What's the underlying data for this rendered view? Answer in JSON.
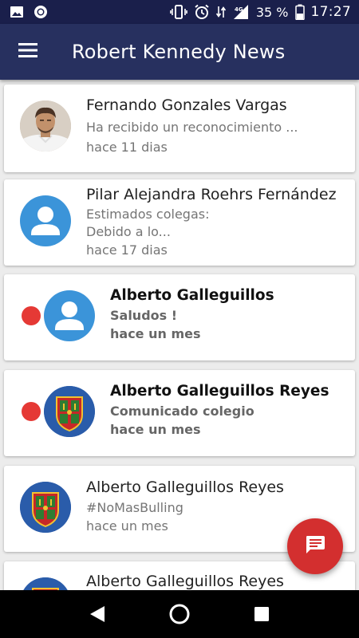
{
  "status_bar": {
    "battery_percent": "35 %",
    "time": "17:27",
    "network": "4G"
  },
  "app_bar": {
    "title": "Robert Kennedy News",
    "menu_icon": "hamburger-menu-icon"
  },
  "messages": [
    {
      "sender": "Fernando Gonzales Vargas",
      "preview": "Ha recibido un reconocimiento ...",
      "time": "hace 11 dias",
      "avatar": "photo",
      "unread": false
    },
    {
      "sender": "Pilar Alejandra  Roehrs Fernández",
      "preview_line1": "Estimados colegas:",
      "preview_line2": "Debido a lo...",
      "time": "hace 17 dias",
      "avatar": "default-person",
      "unread": false
    },
    {
      "sender": "Alberto Galleguillos",
      "preview": "Saludos !",
      "time": "hace un mes",
      "avatar": "default-person",
      "unread": true
    },
    {
      "sender": "Alberto Galleguillos Reyes",
      "preview": "Comunicado colegio",
      "time": "hace un mes",
      "avatar": "school-crest",
      "unread": true
    },
    {
      "sender": "Alberto Galleguillos Reyes",
      "preview": "#NoMasBulling",
      "time": "hace un mes",
      "avatar": "school-crest",
      "unread": false
    },
    {
      "sender": "Alberto Galleguillos Reyes",
      "avatar": "school-crest",
      "unread": false
    }
  ],
  "fab": {
    "icon": "chat-message-icon"
  },
  "colors": {
    "status_bar": "#1a1f4b",
    "app_bar": "#27305f",
    "accent_red": "#d32f2f",
    "avatar_blue": "#3b94d9",
    "unread_dot": "#e53935"
  }
}
